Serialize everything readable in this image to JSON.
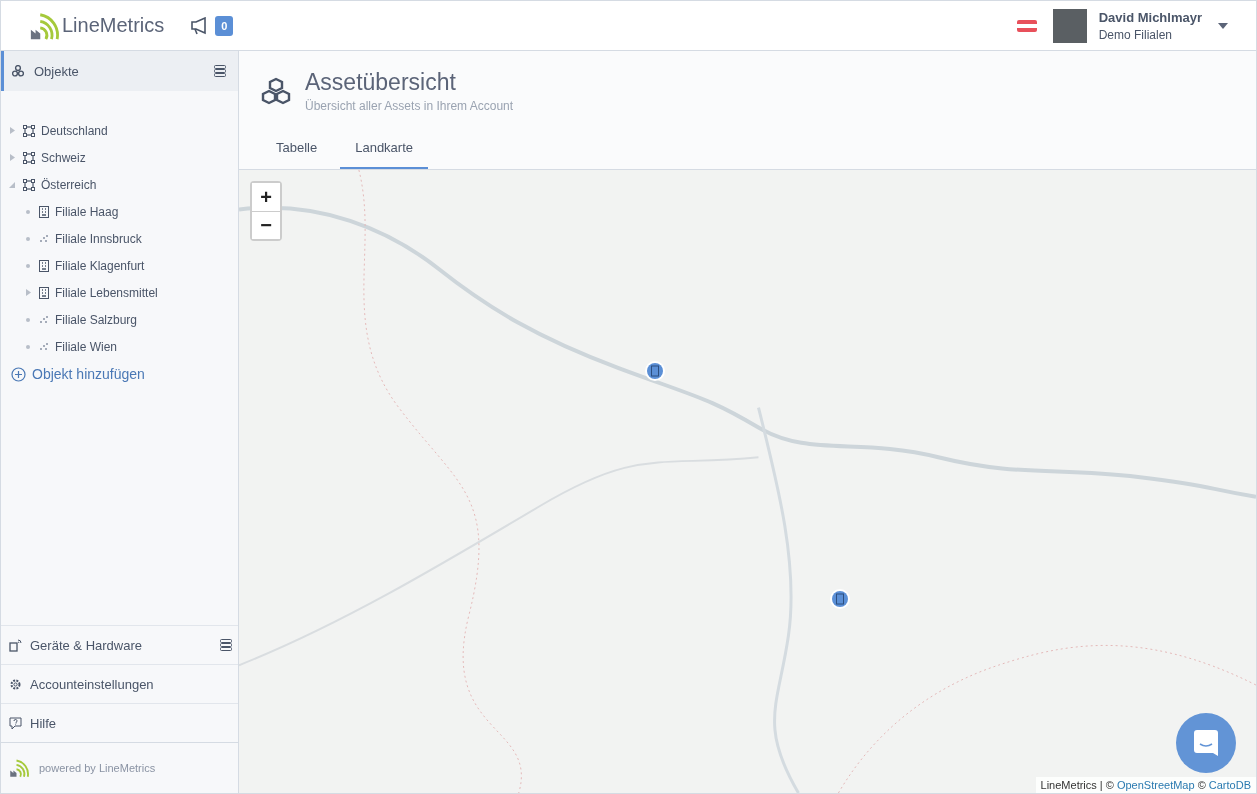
{
  "header": {
    "brand": "LineMetrics",
    "notifications": {
      "count": "0"
    },
    "user": {
      "name": "David Michlmayr",
      "account": "Demo Filialen"
    }
  },
  "sidebar": {
    "section": {
      "label": "Objekte",
      "selected": true
    },
    "tree": [
      {
        "label": "Deutschland",
        "kind": "region",
        "expandable": true,
        "expanded": false
      },
      {
        "label": "Schweiz",
        "kind": "region",
        "expandable": true,
        "expanded": false
      },
      {
        "label": "Österreich",
        "kind": "region",
        "expandable": true,
        "expanded": true,
        "children": [
          {
            "label": "Filiale Haag",
            "kind": "building",
            "expandable": false
          },
          {
            "label": "Filiale Innsbruck",
            "kind": "site",
            "expandable": false
          },
          {
            "label": "Filiale Klagenfurt",
            "kind": "building",
            "expandable": false
          },
          {
            "label": "Filiale Lebensmittel",
            "kind": "building",
            "expandable": true,
            "expanded": false
          },
          {
            "label": "Filiale Salzburg",
            "kind": "site",
            "expandable": false
          },
          {
            "label": "Filiale Wien",
            "kind": "site",
            "expandable": false
          }
        ]
      }
    ],
    "add_label": "Objekt hinzufügen",
    "bottom_items": [
      {
        "label": "Geräte & Hardware",
        "kind": "devices",
        "menu": true
      },
      {
        "label": "Accounteinstellungen",
        "kind": "settings",
        "menu": false
      },
      {
        "label": "Hilfe",
        "kind": "help",
        "menu": false
      }
    ],
    "footer": "powered by LineMetrics"
  },
  "page": {
    "title": "Assetübersicht",
    "subtitle": "Übersicht aller Assets in Ihrem Account",
    "tabs": [
      {
        "label": "Tabelle",
        "selected": false
      },
      {
        "label": "Landkarte",
        "selected": true
      }
    ]
  },
  "map": {
    "zoom_in": "+",
    "zoom_out": "−",
    "attribution": {
      "prefix": "LineMetrics | © ",
      "links": [
        "OpenStreetMap",
        "CartoDB"
      ],
      "separator": " © "
    }
  }
}
